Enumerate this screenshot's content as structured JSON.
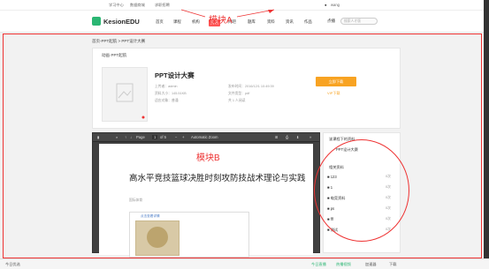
{
  "topbar": {
    "links": [
      "学习中心",
      "数据商城",
      "求职招聘"
    ],
    "user": "wang"
  },
  "header": {
    "logo": "KesionEDU",
    "nav": [
      "首页",
      "课程",
      "机构",
      "资讯",
      "问吧",
      "题库",
      "资料",
      "资讯",
      "作品",
      "商城"
    ],
    "active_index": 3,
    "login": "点播",
    "search_placeholder": "搜索人才版"
  },
  "annotations": {
    "a": "模块A",
    "b": "模块B"
  },
  "breadcrumb": "首页-PPT起航 > PPT设计大赛",
  "section_title": "动画·PPT起航",
  "resource": {
    "title": "PPT设计大赛",
    "uploader": "上传者：admin",
    "size": "资料大小：145.51KB",
    "category": "适应对象：普通",
    "upload_time": "发布时间：2016/12/1 10:49:39",
    "type": "文件类型：pdf",
    "downloads": "共 1 人阅读",
    "download_btn": "立即下载",
    "vip_link": "VIP下载"
  },
  "viewer": {
    "page_label": "Page",
    "page_num": "1",
    "page_total": "of 5",
    "zoom": "Automatic Zoom"
  },
  "document": {
    "title": "高水平竞技篮球决胜时刻攻防技战术理论与实践",
    "author": "国际体育",
    "box_caption": "点击查看详情"
  },
  "sidebar": {
    "head1": "该课程下的资料",
    "item1": "PPT设计大赛",
    "head2": "相关资料",
    "items": [
      {
        "label": "123",
        "count": "0次"
      },
      {
        "label": "1",
        "count": "0次"
      },
      {
        "label": "电竞资料",
        "count": "0次"
      },
      {
        "label": "ps",
        "count": "0次"
      },
      {
        "label": "fff",
        "count": "0次"
      },
      {
        "label": "测试",
        "count": "0次"
      }
    ]
  },
  "bottombar": {
    "left": "今日优选",
    "items": [
      "今日直播",
      "热播视频",
      "加速器",
      "下载"
    ]
  },
  "colors": {
    "accent": "#2bb673",
    "annotation": "#e33",
    "download": "#f8a322"
  }
}
